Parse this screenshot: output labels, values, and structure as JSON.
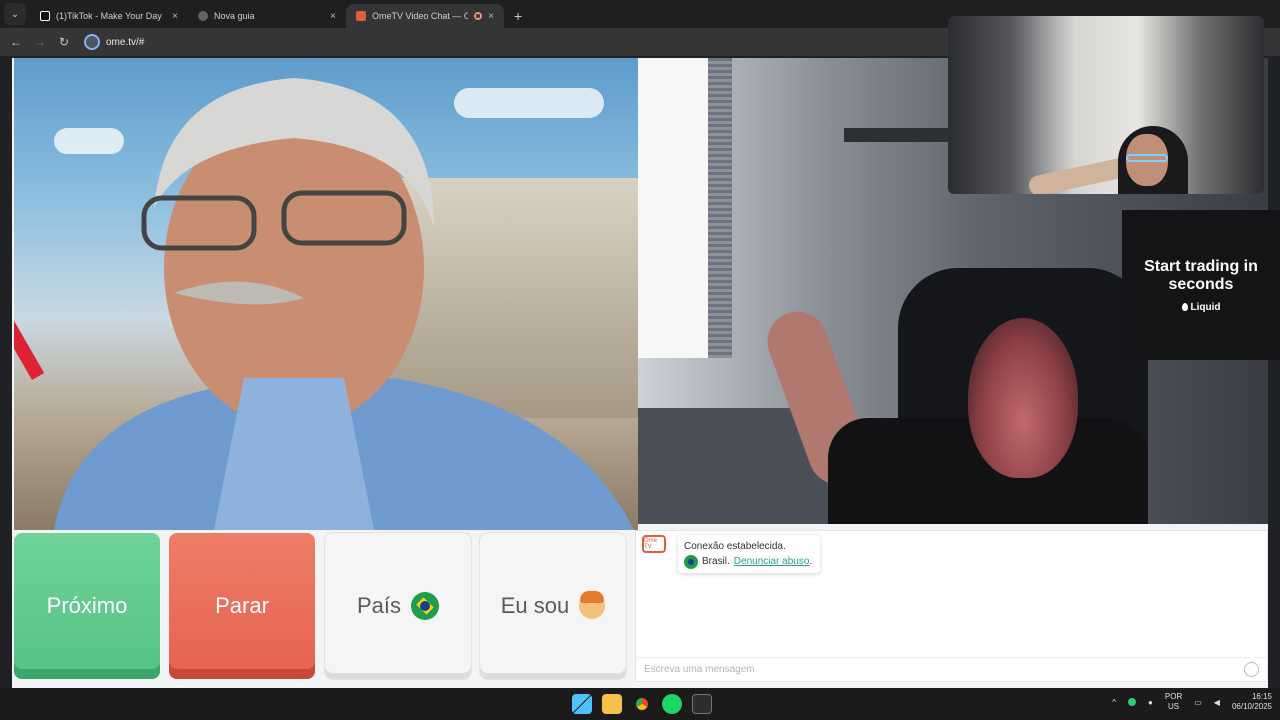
{
  "browser": {
    "tabs": [
      {
        "title": "(1)TikTok - Make Your Day",
        "close": "×",
        "active": false,
        "favicon_color": "#111111"
      },
      {
        "title": "Nova guia",
        "close": "×",
        "active": false,
        "favicon_color": "#5f6368"
      },
      {
        "title": "OmeTV Video Chat — Ome",
        "close": "×",
        "active": true,
        "favicon_color": "#e25d3f"
      }
    ],
    "tab_menu": "⌄",
    "new_tab": "+",
    "back": "←",
    "forward": "→",
    "reload": "↻",
    "url": "ome.tv/#"
  },
  "controls": {
    "next_label": "Próximo",
    "stop_label": "Parar",
    "country_label": "País",
    "iam_label": "Eu sou"
  },
  "chat": {
    "logo": "Ome TV",
    "status": "Conexão estabelecida.",
    "country": "Brasil.",
    "report_link": "Denunciar abuso",
    "report_suffix": ".",
    "input_placeholder": "Escreva uma mensagem"
  },
  "ad": {
    "headline": "Start trading in seconds",
    "brand": "Liquid"
  },
  "taskbar": {
    "lang_top": "POR",
    "lang_bottom": "US",
    "time": "16:15",
    "date": "06/10/2025"
  },
  "colors": {
    "next": "#57c184",
    "stop": "#e4634e",
    "link": "#2a9d8f"
  }
}
